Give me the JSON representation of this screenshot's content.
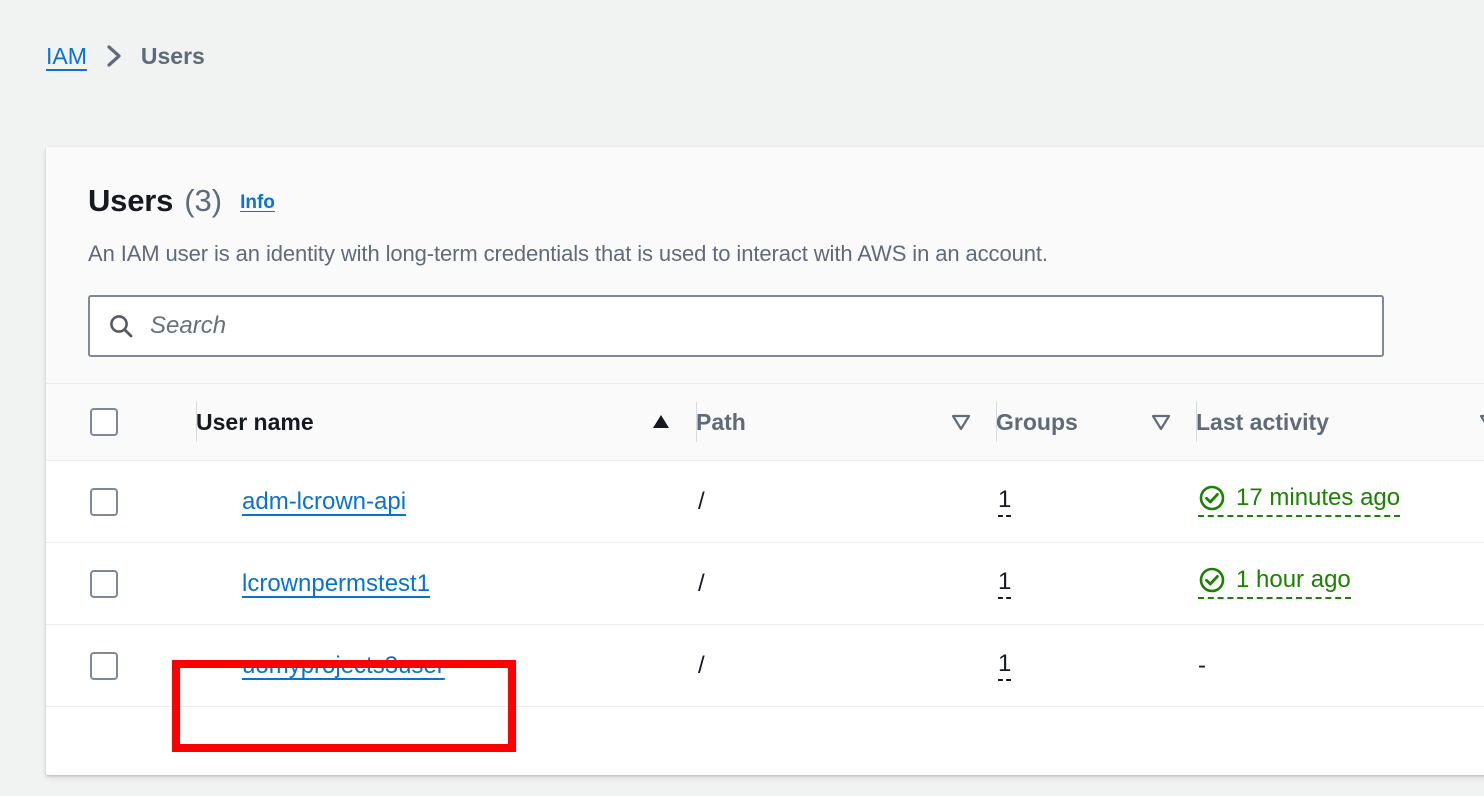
{
  "breadcrumb": {
    "root_label": "IAM",
    "separator_icon": "chevron-right-icon",
    "current_label": "Users"
  },
  "panel": {
    "title": "Users",
    "count": "(3)",
    "info_label": "Info",
    "description": "An IAM user is an identity with long-term credentials that is used to interact with AWS in an account.",
    "search": {
      "placeholder": "Search",
      "value": "",
      "icon": "search-icon"
    }
  },
  "table": {
    "columns": [
      {
        "key": "select",
        "label": "",
        "sort": "none"
      },
      {
        "key": "user_name",
        "label": "User name",
        "sort": "asc",
        "sort_icon": "sort-ascending-filled-icon"
      },
      {
        "key": "path",
        "label": "Path",
        "sort": "none",
        "sort_icon": "sort-descending-outline-icon"
      },
      {
        "key": "groups",
        "label": "Groups",
        "sort": "none",
        "sort_icon": "sort-descending-outline-icon"
      },
      {
        "key": "last_activity",
        "label": "Last activity",
        "sort": "none",
        "sort_icon": "sort-descending-outline-icon"
      }
    ],
    "rows": [
      {
        "user_name": "adm-lcrown-api",
        "path": "/",
        "groups": "1",
        "last_activity": "17 minutes ago",
        "last_activity_status": "success",
        "status_icon": "check-circle-icon",
        "highlighted": false
      },
      {
        "user_name": "lcrownpermstest1",
        "path": "/",
        "groups": "1",
        "last_activity": "1 hour ago",
        "last_activity_status": "success",
        "status_icon": "check-circle-icon",
        "highlighted": false
      },
      {
        "user_name": "uomyprojects3user",
        "path": "/",
        "groups": "1",
        "last_activity": "-",
        "last_activity_status": "none",
        "status_icon": "",
        "highlighted": true
      }
    ]
  },
  "colors": {
    "link": "#0972d3",
    "text": "#16191f",
    "muted": "#5f6b7a",
    "success": "#1d8102",
    "page_background": "#f1f3f3",
    "panel_background": "#ffffff",
    "header_background": "#fafafa",
    "highlight": "#ff0000"
  }
}
